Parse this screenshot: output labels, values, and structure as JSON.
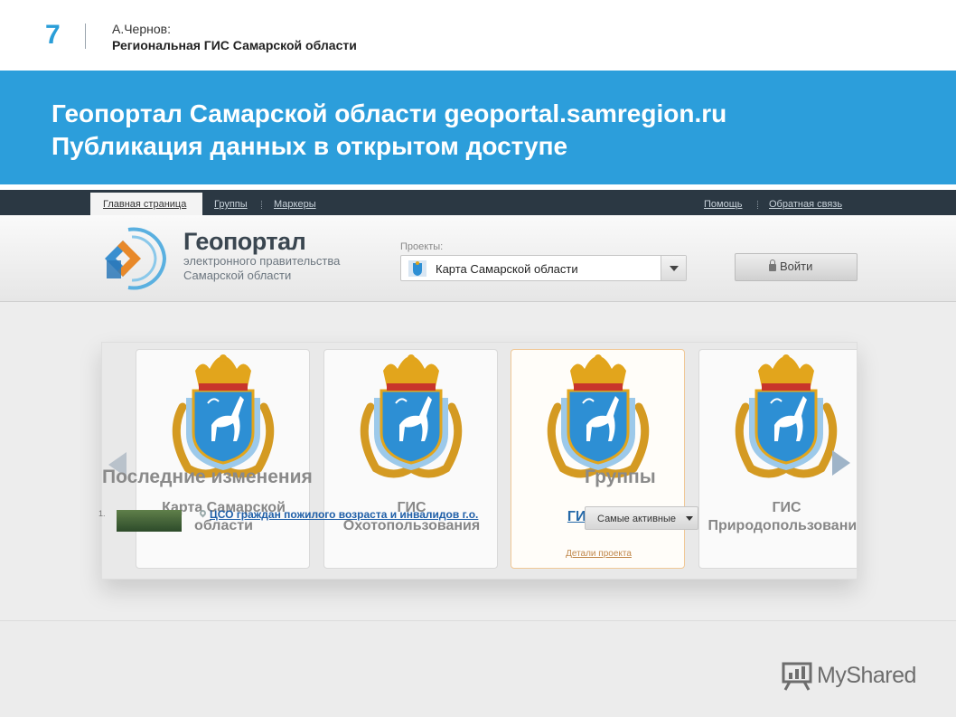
{
  "slide": {
    "number": "7",
    "author": "А.Чернов:",
    "subtitle": "Региональная ГИС Самарской области",
    "banner_line1": "Геопортал Самарской области geoportal.samregion.ru",
    "banner_line2": "Публикация данных в открытом доступе"
  },
  "site": {
    "nav": {
      "home": "Главная страница",
      "groups": "Группы",
      "markers": "Маркеры",
      "help": "Помощь",
      "feedback": "Обратная связь"
    },
    "logo": {
      "title": "Геопортал",
      "sub1": "электронного правительства",
      "sub2": "Самарской области"
    },
    "projects": {
      "label": "Проекты:",
      "selected": "Карта Самарской области"
    },
    "login_label": "Войти",
    "cards": [
      {
        "title_line1": "Карта Самарской",
        "title_line2": "области"
      },
      {
        "title_line1": "ГИС",
        "title_line2": "Охотопользования"
      },
      {
        "title_line1": "ГИС АПК",
        "link": "Детали проекта"
      },
      {
        "title_line1": "ГИС",
        "title_line2": "Природопользования"
      }
    ],
    "recent": {
      "heading": "Последние изменения",
      "items": [
        {
          "num": "1.",
          "text": "ЦСО граждан пожилого возраста и инвалидов г.о."
        }
      ]
    },
    "groups": {
      "heading": "Группы",
      "select": "Самые активные"
    }
  },
  "watermark": "MyShared",
  "colors": {
    "banner": "#2c9edb",
    "nav_bar": "#2b3843",
    "link": "#1f5fa8",
    "crest_shield": "#2d8fd4",
    "crest_crown": "#e2a51c"
  }
}
